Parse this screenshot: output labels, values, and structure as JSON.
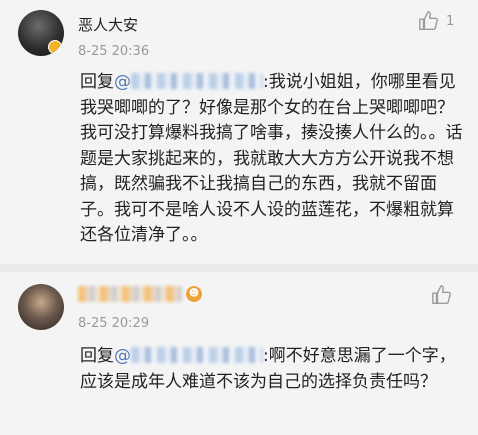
{
  "comments": [
    {
      "username": "恶人大安",
      "time": "8-25 20:36",
      "like_count": "1",
      "reply_prefix": "回复",
      "mention_at": "@",
      "text": ":我说小姐姐，你哪里看见我哭唧唧的了？好像是那个女的在台上哭唧唧吧？我可没打算爆料我搞了啥事，揍没揍人什么的。。话题是大家挑起来的，我就敢大大方方公开说我不想搞，既然骗我不让我搞自己的东西，我就不留面子。我可不是啥人设不人设的蓝莲花，不爆粗就算还各位清净了。。"
    },
    {
      "time": "8-25 20:29",
      "reply_prefix": "回复",
      "mention_at": "@",
      "text": ":啊不好意思漏了一个字，应该是成年人难道不该为自己的选择负责任吗？"
    }
  ],
  "icons": {
    "like": "thumbs-up-icon",
    "avatar_badge": "verified-badge-icon"
  },
  "colors": {
    "mention": "#4f7ab5",
    "timestamp": "#9a9a9a",
    "background": "#f4f4f4"
  }
}
